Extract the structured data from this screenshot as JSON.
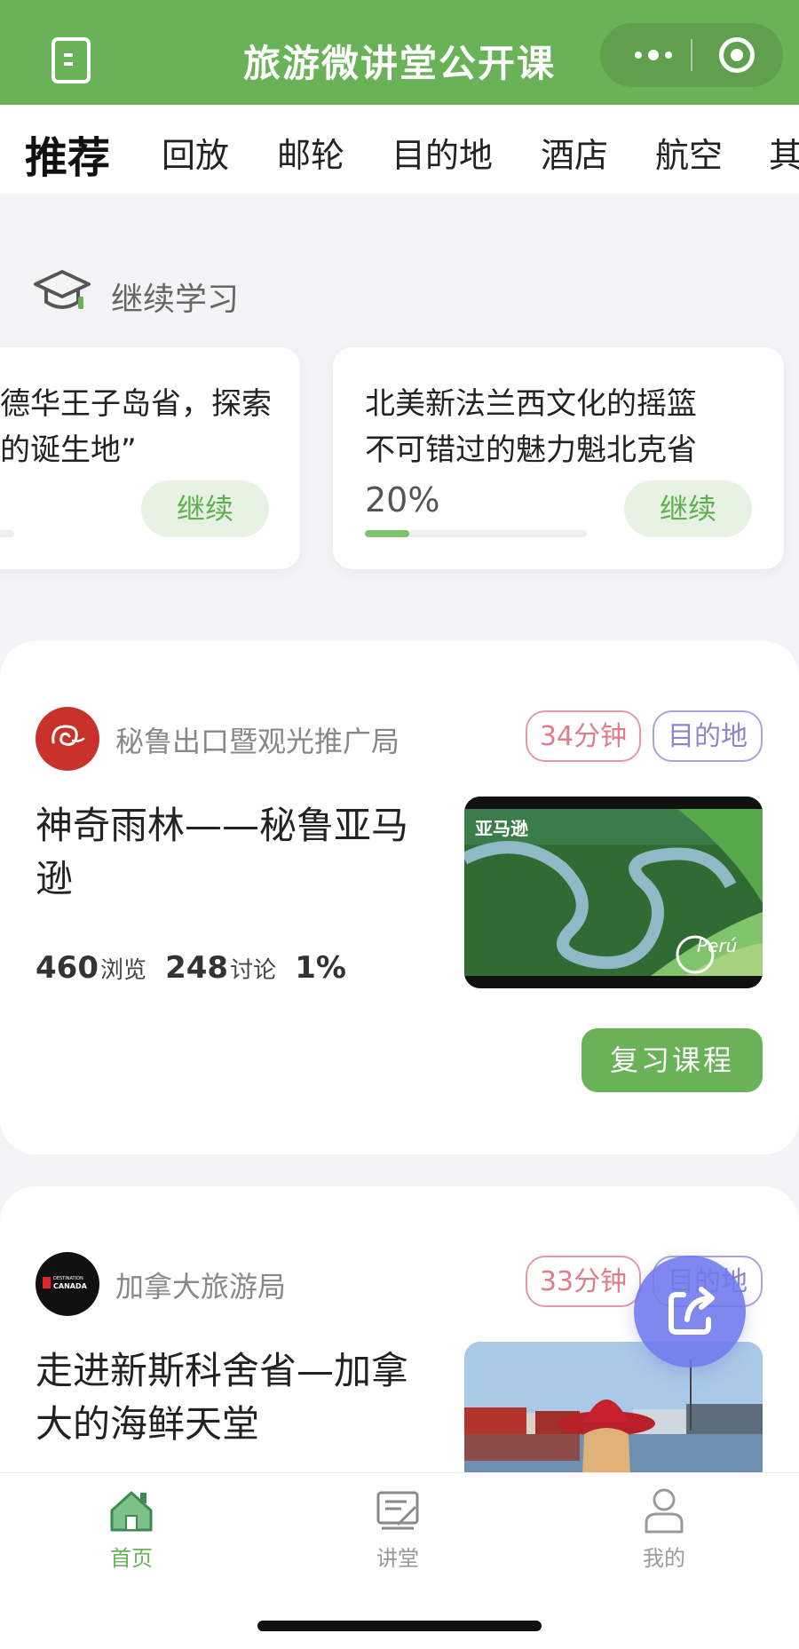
{
  "header": {
    "title": "旅游微讲堂公开课"
  },
  "tabs": [
    {
      "label": "推荐",
      "active": true
    },
    {
      "label": "回放"
    },
    {
      "label": "邮轮"
    },
    {
      "label": "目的地"
    },
    {
      "label": "酒店"
    },
    {
      "label": "航空"
    },
    {
      "label": "其"
    }
  ],
  "continue_learning": {
    "title": "继续学习",
    "cards": [
      {
        "line1": "德华王子岛省，探索",
        "line2": "的诞生地”",
        "button": "继续"
      },
      {
        "line1": "北美新法兰西文化的摇篮",
        "line2": "不可错过的魅力魁北克省",
        "progress_text": "20%",
        "progress": 0.2,
        "button": "继续"
      }
    ]
  },
  "courses": [
    {
      "org": "秘鲁出口暨观光推广局",
      "duration": "34分钟",
      "category": "目的地",
      "title": "神奇雨林——秘鲁亚马逊",
      "views": "460",
      "views_unit": "浏览",
      "discussions": "248",
      "discussions_unit": "讨论",
      "progress": "1%",
      "thumb_caption": "亚马逊",
      "thumb_brand": "Perú",
      "button": "复习课程"
    },
    {
      "org": "加拿大旅游局",
      "duration": "33分钟",
      "category": "目的地",
      "title": "走进新斯科舍省—加拿大的海鲜天堂",
      "logo_text_1": "DESTINATION",
      "logo_text_2": "CANADA"
    }
  ],
  "bottom_nav": [
    {
      "label": "首页",
      "icon": "home-icon",
      "active": true
    },
    {
      "label": "讲堂",
      "icon": "lecture-icon"
    },
    {
      "label": "我的",
      "icon": "profile-icon"
    }
  ],
  "colors": {
    "brand_green": "#6ab257",
    "tag_pink": "#e07c8c",
    "tag_purple": "#8d86cd",
    "fab_purple": "#6e78ee"
  }
}
